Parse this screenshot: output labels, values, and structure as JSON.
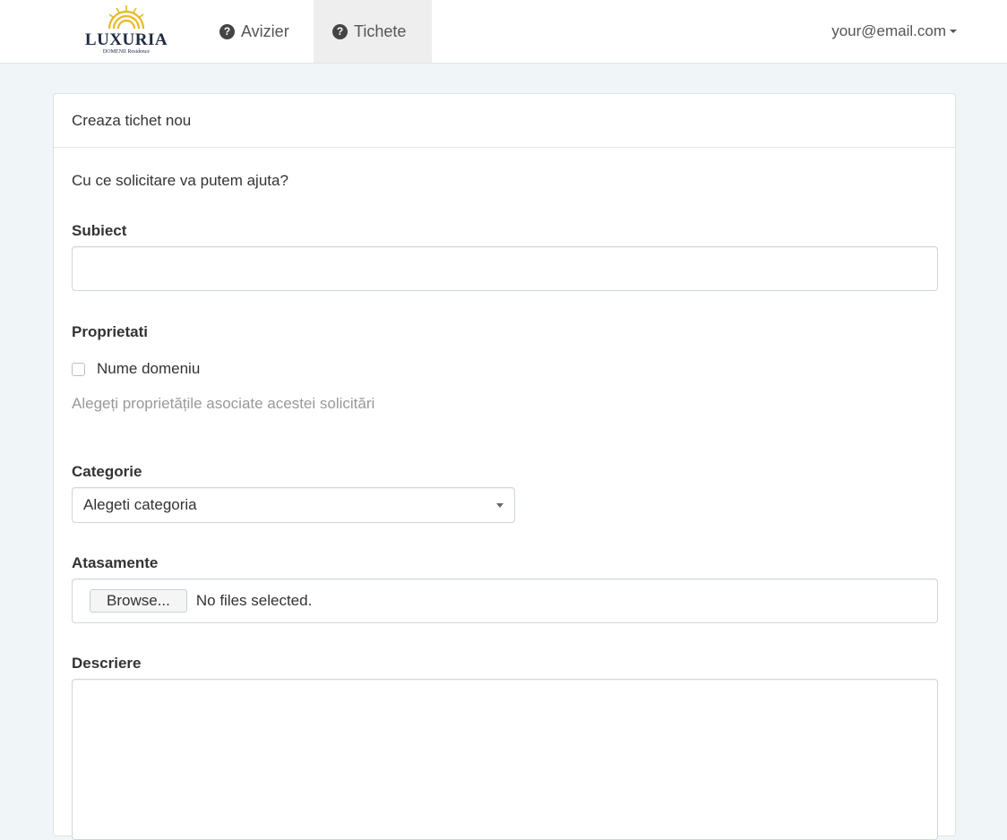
{
  "navbar": {
    "brand": "LUXURIA",
    "brand_sub": "DOMENII Residence",
    "items": [
      {
        "label": "Avizier",
        "icon": "question-circle-icon",
        "active": false
      },
      {
        "label": "Tichete",
        "icon": "question-circle-icon",
        "active": true
      }
    ],
    "user_email": "your@email.com",
    "icon_glyph": "?"
  },
  "panel": {
    "heading": "Creaza tichet nou",
    "intro": "Cu ce solicitare va putem ajuta?"
  },
  "form": {
    "subject_label": "Subiect",
    "subject_value": "",
    "properties_label": "Proprietati",
    "property_option": "Nume domeniu",
    "property_checked": false,
    "properties_help": "Alegeți proprietățile asociate acestei solicitări",
    "category_label": "Categorie",
    "category_selected": "Alegeti categoria",
    "attachments_label": "Atasamente",
    "browse_label": "Browse...",
    "no_files_text": "No files selected.",
    "description_label": "Descriere",
    "description_value": ""
  },
  "colors": {
    "page_bg": "#f0f5f7",
    "logo_gold": "#e8b923",
    "brand_navy": "#1f2a44"
  }
}
